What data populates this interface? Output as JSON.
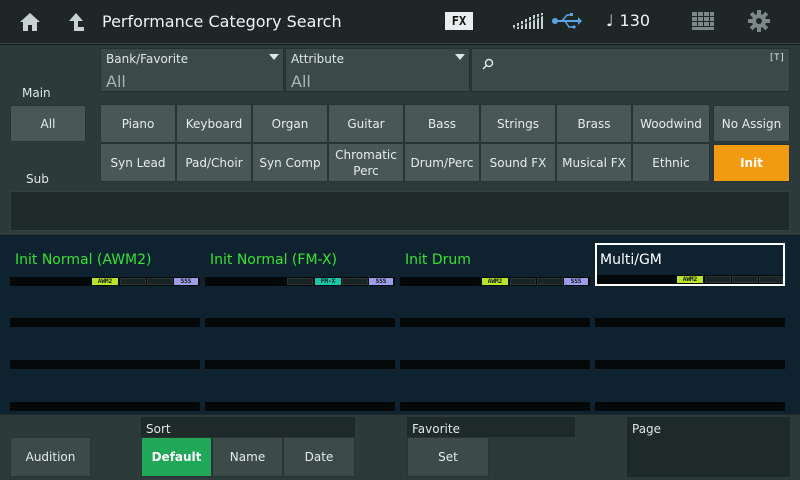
{
  "header": {
    "title": "Performance Category Search",
    "fx_badge": "FX",
    "tempo_note": "♩",
    "tempo": "130",
    "icons": [
      "home-icon",
      "up-arrow-icon",
      "level-meter-icon",
      "usb-icon",
      "grid-icon",
      "gear-icon"
    ]
  },
  "search": {
    "main_label": "Main",
    "sub_label": "Sub",
    "bank_favorite": {
      "label": "Bank/Favorite",
      "value": "All"
    },
    "attribute": {
      "label": "Attribute",
      "value": "All"
    },
    "keyword": {
      "placeholder": "",
      "t_icon": "[T]"
    }
  },
  "categories": {
    "all_label": "All",
    "main": [
      "Piano",
      "Keyboard",
      "Organ",
      "Guitar",
      "Bass",
      "Strings",
      "Brass",
      "Woodwind"
    ],
    "sub": [
      "Syn Lead",
      "Pad/Choir",
      "Syn Comp",
      "Chromatic Perc",
      "Drum/Perc",
      "Sound FX",
      "Musical FX",
      "Ethnic"
    ],
    "no_assign": "No Assign",
    "init": "Init"
  },
  "results": [
    {
      "name": "Init Normal (AWM2)",
      "tag": "AWM2",
      "tag_type": "awm",
      "sss": "SSS",
      "selected": false
    },
    {
      "name": "Init Normal (FM-X)",
      "tag": "FM-X",
      "tag_type": "fmx",
      "sss": "SSS",
      "selected": false
    },
    {
      "name": "Init Drum",
      "tag": "AWM2",
      "tag_type": "awm",
      "sss": "SSS",
      "selected": false
    },
    {
      "name": "Multi/GM",
      "tag": "AWM2",
      "tag_type": "awm",
      "sss": "",
      "selected": true
    }
  ],
  "bottom": {
    "audition": "Audition",
    "sort_label": "Sort",
    "sort_options": [
      "Default",
      "Name",
      "Date"
    ],
    "sort_selected": "Default",
    "favorite_label": "Favorite",
    "favorite_set": "Set",
    "page_label": "Page"
  },
  "colors": {
    "accent_orange": "#f29a10",
    "accent_green": "#20a858",
    "result_text_green": "#36e236",
    "awm_tag": "#b8e52a",
    "fmx_tag": "#19c6a8",
    "sss_tag": "#9a9ee8"
  }
}
